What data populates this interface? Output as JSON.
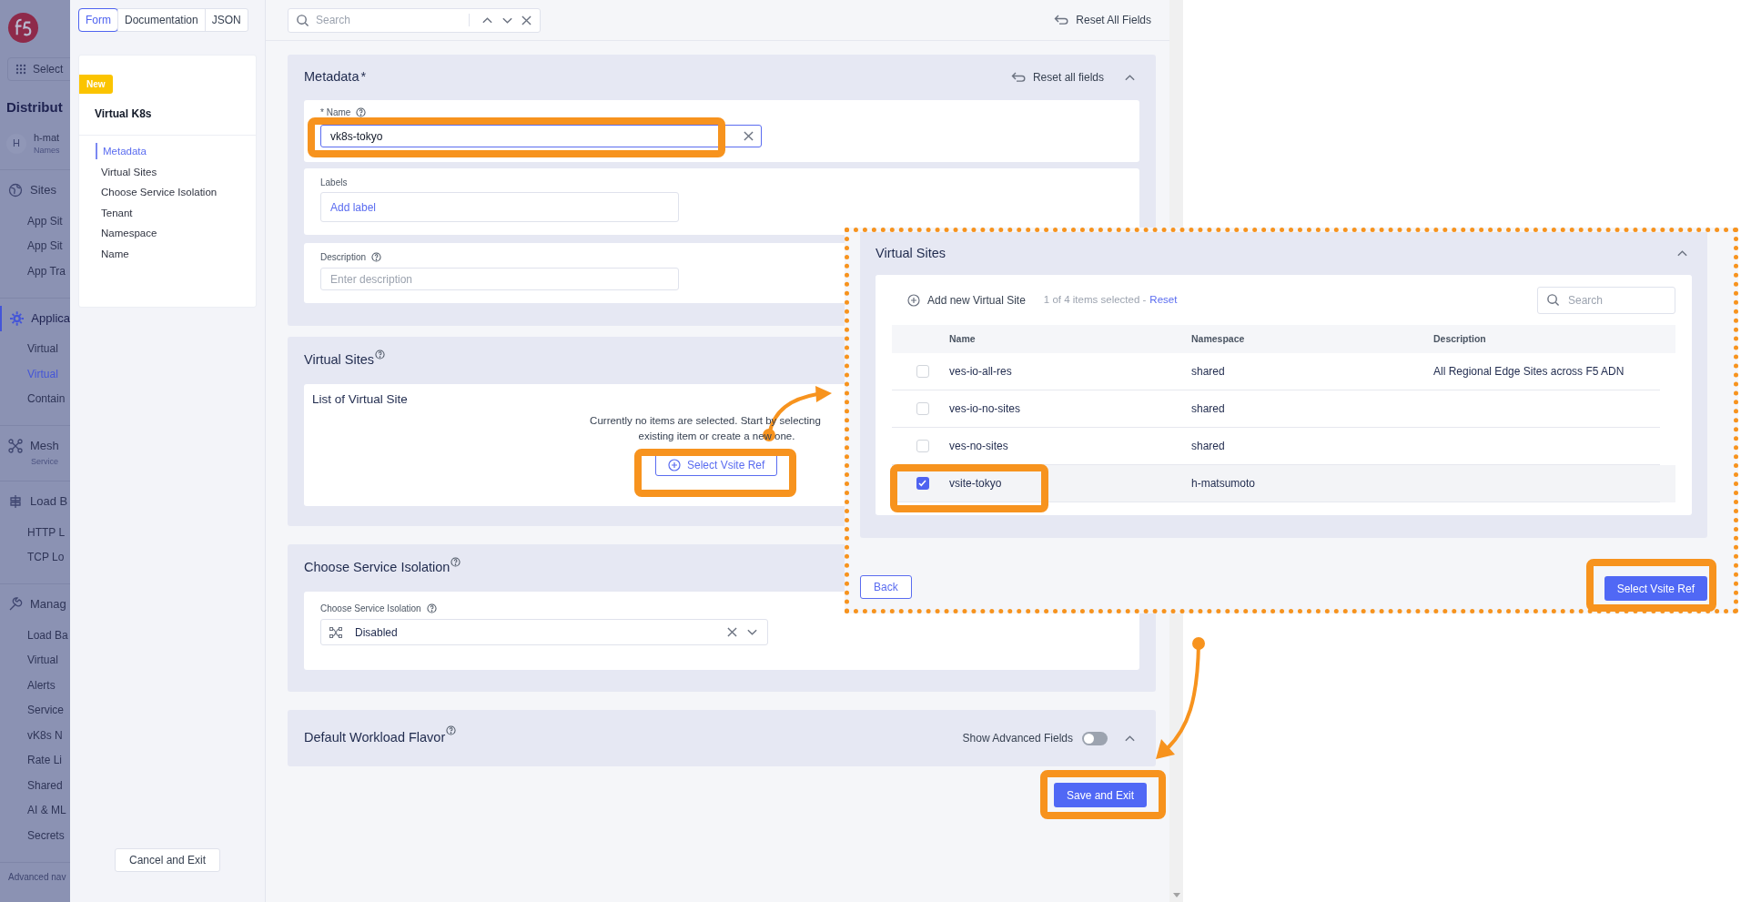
{
  "side_nav": {
    "workspace_selector": "Select",
    "title": "Distribut",
    "namespace": {
      "avatar": "H",
      "name": "h-mat",
      "label": "Names"
    },
    "groups": [
      {
        "title": "Sites",
        "selected": false,
        "items": [
          {
            "label": "App Sit",
            "selected": false
          },
          {
            "label": "App Sit",
            "selected": false
          },
          {
            "label": "App Tra",
            "selected": false
          }
        ]
      },
      {
        "title": "Applica",
        "selected": true,
        "items": [
          {
            "label": "Virtual",
            "selected": false
          },
          {
            "label": "Virtual",
            "selected": true
          },
          {
            "label": "Contain",
            "selected": false
          }
        ]
      },
      {
        "title": "Mesh",
        "selected": false,
        "subtitle": "Service"
      },
      {
        "title": "Load B",
        "selected": false,
        "items": [
          {
            "label": "HTTP L",
            "selected": false
          },
          {
            "label": "TCP Lo",
            "selected": false
          }
        ]
      },
      {
        "title": "Manag",
        "selected": false,
        "items": [
          {
            "label": "Load Ba",
            "selected": false
          },
          {
            "label": "Virtual",
            "selected": false
          },
          {
            "label": "Alerts",
            "selected": false
          },
          {
            "label": "Service",
            "selected": false
          },
          {
            "label": "vK8s N",
            "selected": false
          },
          {
            "label": "Rate Li",
            "selected": false
          },
          {
            "label": "Shared",
            "selected": false
          },
          {
            "label": "AI & ML",
            "selected": false
          },
          {
            "label": "Secrets",
            "selected": false
          }
        ]
      }
    ],
    "footer": "Advanced nav"
  },
  "form": {
    "tabs": [
      {
        "label": "Form",
        "selected": true
      },
      {
        "label": "Documentation",
        "selected": false
      },
      {
        "label": "JSON",
        "selected": false
      }
    ],
    "badge": "New",
    "title": "Virtual K8s",
    "sections": [
      {
        "label": "Metadata",
        "selected": true
      },
      {
        "label": "Virtual Sites",
        "selected": false
      },
      {
        "label": "Choose Service Isolation",
        "selected": false
      },
      {
        "label": "Tenant",
        "selected": false
      },
      {
        "label": "Namespace",
        "selected": false
      },
      {
        "label": "Name",
        "selected": false
      }
    ],
    "cancel_button": "Cancel and Exit"
  },
  "toolbar": {
    "search_placeholder": "Search",
    "reset": "Reset All Fields"
  },
  "metadata": {
    "title": "Metadata",
    "required_mark": "*",
    "reset": "Reset all fields",
    "name_label": "* Name",
    "name_value": "vk8s-tokyo",
    "labels_label": "Labels",
    "add_label": "Add label",
    "description_label": "Description",
    "description_placeholder": "Enter description"
  },
  "virtual_sites": {
    "title": "Virtual Sites",
    "list_title": "List of Virtual Site",
    "empty_line_1": "Currently no items are selected. Start by selecting",
    "empty_line_2": "existing item or create a new one.",
    "button": "Select Vsite Ref"
  },
  "service_isolation": {
    "title": "Choose Service Isolation",
    "field_label": "Choose Service Isolation",
    "value": "Disabled"
  },
  "workload_flavor": {
    "title": "Default Workload Flavor",
    "advanced_label": "Show Advanced Fields",
    "advanced_on": false
  },
  "save_button": "Save and Exit",
  "callout": {
    "title": "Virtual Sites",
    "add_new": "Add new Virtual Site",
    "selection": "1 of 4 items selected -",
    "reset": "Reset",
    "search_placeholder": "Search",
    "columns": [
      "Name",
      "Namespace",
      "Description"
    ],
    "rows": [
      {
        "name": "ves-io-all-res",
        "namespace": "shared",
        "description": "All Regional Edge Sites across F5 ADN",
        "checked": false
      },
      {
        "name": "ves-io-no-sites",
        "namespace": "shared",
        "checked": false
      },
      {
        "name": "ves-no-sites",
        "namespace": "shared",
        "checked": false
      },
      {
        "name": "vsite-tokyo",
        "namespace": "h-matsumoto",
        "checked": true
      }
    ],
    "back_button": "Back",
    "select_button": "Select Vsite Ref"
  }
}
